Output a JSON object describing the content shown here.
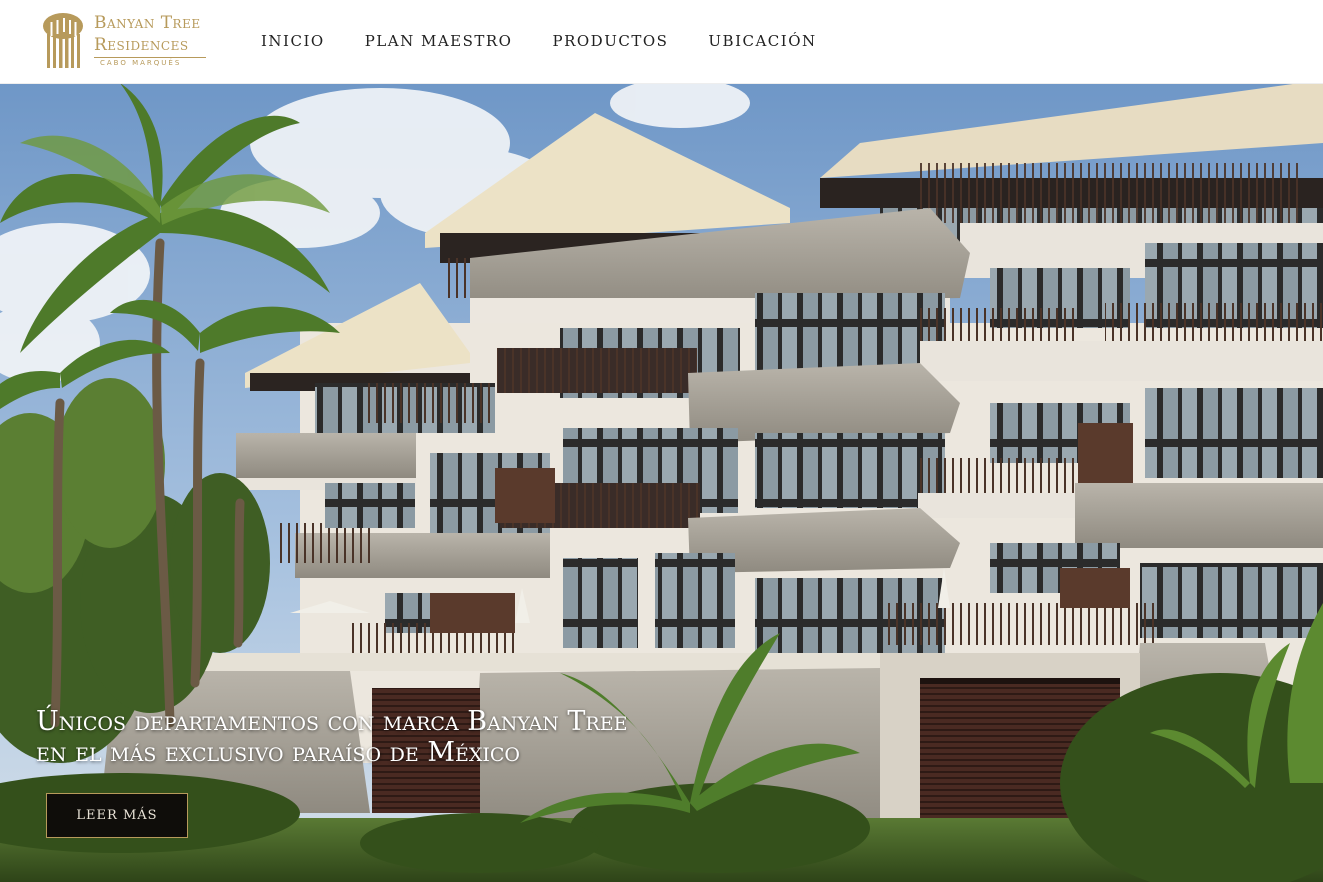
{
  "brand": {
    "line1": "Banyan Tree",
    "line2": "Residences",
    "subline": "CABO MARQUÉS",
    "color": "#b79a5b"
  },
  "nav": {
    "items": [
      "INICIO",
      "PLAN MAESTRO",
      "PRODUCTOS",
      "UBICACIÓN"
    ]
  },
  "hero": {
    "headline_line1": "Únicos departamentos con marca Banyan Tree",
    "headline_line2": "en el más exclusivo paraíso de México",
    "cta_label": "LEER MÁS"
  }
}
